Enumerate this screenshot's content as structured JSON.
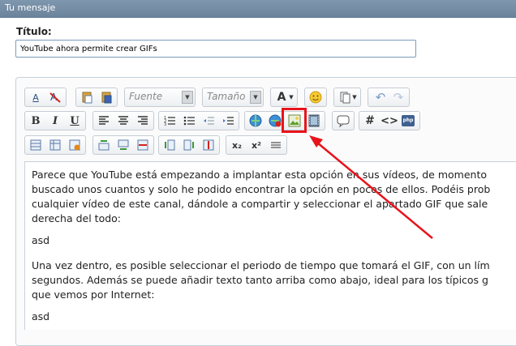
{
  "header": {
    "title": "Tu mensaje"
  },
  "form": {
    "title_label": "Título:",
    "title_value": "YouTube ahora permite crear GIFs"
  },
  "toolbar": {
    "font_placeholder": "Fuente",
    "size_placeholder": "Tamaño",
    "font_color_label": "A",
    "bold_label": "B",
    "italic_label": "I",
    "underline_label": "U",
    "hash_label": "#",
    "code_label": "<>",
    "php_label": "php",
    "subscript_label": "x₂",
    "superscript_label": "x²"
  },
  "content": {
    "paragraph1": [
      "Parece que YouTube está empezando a implantar esta opción en sus vídeos, de momento",
      "buscado unos cuantos y solo he podido encontrar la opción en pocos de ellos. Podéis prob",
      "cualquier vídeo de este canal, dándole a compartir y seleccionar el apartado GIF que sale",
      "derecha del todo:"
    ],
    "line_asd1": "asd",
    "paragraph2": [
      "Una vez dentro, es posible seleccionar el periodo de tiempo que tomará el GIF, con un lím",
      "segundos. Además se puede añadir texto tanto arriba como abajo, ideal para los típicos g",
      "que vemos por Internet:"
    ],
    "line_asd2": "asd"
  },
  "colors": {
    "header_bg": "#7891a8",
    "highlight": "#e8141b",
    "input_border": "#7b9bbd"
  }
}
